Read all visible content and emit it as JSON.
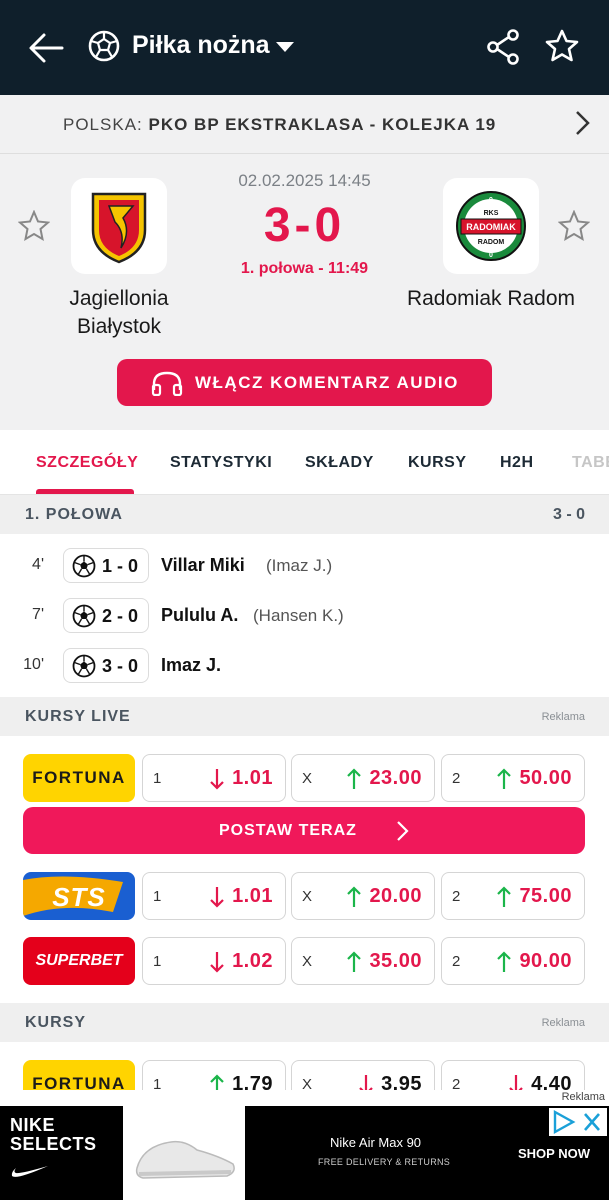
{
  "header": {
    "title": "Piłka nożna"
  },
  "league": {
    "country": "POLSKA:",
    "competition": "PKO BP EKSTRAKLASA - KOLEJKA 19"
  },
  "match": {
    "datetime": "02.02.2025 14:45",
    "score": "3-0",
    "period": "1. połowa - 11:49",
    "home": {
      "name_line1": "Jagiellonia",
      "name_line2": "Białystok"
    },
    "away": {
      "name": "Radomiak Radom",
      "badge_top": "RKS",
      "badge_mid": "RADOMIAK",
      "badge_bottom": "RADOM",
      "badge_year_top": "9",
      "badge_year_bottom": "0"
    },
    "audio_button": "WŁĄCZ KOMENTARZ AUDIO"
  },
  "tabs": [
    {
      "label": "SZCZEGÓŁY"
    },
    {
      "label": "STATYSTYKI"
    },
    {
      "label": "SKŁADY"
    },
    {
      "label": "KURSY"
    },
    {
      "label": "H2H"
    },
    {
      "label": "TABE"
    }
  ],
  "first_half": {
    "label": "1. POŁOWA",
    "score": "3 - 0",
    "events": [
      {
        "minute": "4'",
        "score": "1 - 0",
        "player": "Villar Miki",
        "assist": "(Imaz J.)"
      },
      {
        "minute": "7'",
        "score": "2 - 0",
        "player": "Pululu A.",
        "assist": "(Hansen K.)"
      },
      {
        "minute": "10'",
        "score": "3 - 0",
        "player": "Imaz J.",
        "assist": ""
      }
    ]
  },
  "live_odds": {
    "label": "KURSY LIVE",
    "ad_label": "Reklama",
    "bet_button": "POSTAW TERAZ",
    "rows": [
      {
        "bookie": "FORTUNA",
        "odds": [
          {
            "k": "1",
            "dir": "down",
            "v": "1.01"
          },
          {
            "k": "X",
            "dir": "up",
            "v": "23.00"
          },
          {
            "k": "2",
            "dir": "up",
            "v": "50.00"
          }
        ]
      },
      {
        "bookie": "STS",
        "odds": [
          {
            "k": "1",
            "dir": "down",
            "v": "1.01"
          },
          {
            "k": "X",
            "dir": "up",
            "v": "20.00"
          },
          {
            "k": "2",
            "dir": "up",
            "v": "75.00"
          }
        ]
      },
      {
        "bookie": "SUPERBET",
        "odds": [
          {
            "k": "1",
            "dir": "down",
            "v": "1.02"
          },
          {
            "k": "X",
            "dir": "up",
            "v": "35.00"
          },
          {
            "k": "2",
            "dir": "up",
            "v": "90.00"
          }
        ]
      }
    ]
  },
  "prematch_odds": {
    "label": "KURSY",
    "ad_label": "Reklama",
    "rows": [
      {
        "bookie": "FORTUNA",
        "odds": [
          {
            "k": "1",
            "dir": "up",
            "v": "1.79"
          },
          {
            "k": "X",
            "dir": "down",
            "v": "3.95"
          },
          {
            "k": "2",
            "dir": "down",
            "v": "4.40"
          }
        ]
      }
    ]
  },
  "banner": {
    "ad_label": "Reklama",
    "brand_line1": "NIKE",
    "brand_line2": "SELECTS",
    "product": "Nike Air Max 90",
    "delivery": "FREE DELIVERY & RETURNS",
    "cta": "SHOP NOW"
  },
  "colors": {
    "accent": "#e3174c",
    "header_bg": "#0f1f2b",
    "up": "#1bb54a",
    "down": "#e3174c",
    "fortuna": "#ffd400",
    "sts": "#1a5fd1",
    "superbet": "#e4001b"
  }
}
